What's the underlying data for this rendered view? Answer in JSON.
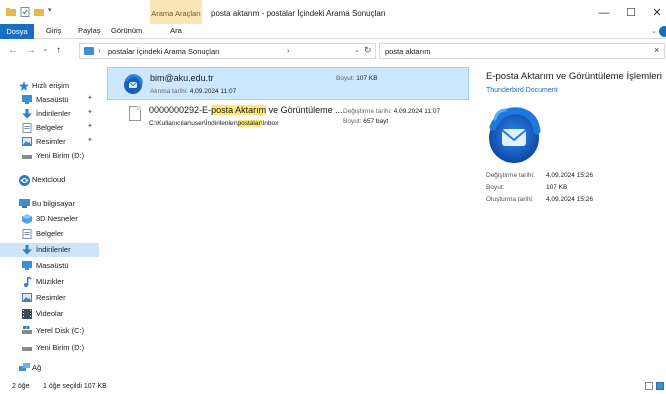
{
  "titlebar": {
    "tool_tab_top": "Arama Araçları",
    "window_title": "posta aktarım - postalar İçindeki Arama Sonuçları",
    "minimize_glyph": "—",
    "maximize_glyph": "☐",
    "close_glyph": "✕"
  },
  "ribbon": {
    "tabs": [
      "Dosya",
      "Giriş",
      "Paylaş",
      "Görünüm",
      "Ara"
    ]
  },
  "address": {
    "back": "←",
    "forward": "→",
    "recent": "⌄",
    "up": "↑",
    "sep": "›",
    "path": "postalar İçindeki Arama Sonuçları",
    "dropdown": "⌄",
    "refresh": "↻",
    "search_value": "posta aktarım",
    "search_clear": "×"
  },
  "nav": {
    "items": [
      {
        "label": "Hızlı erişim",
        "icon": "star-icon",
        "pinned": false
      },
      {
        "label": "Masaüstü",
        "icon": "desktop-icon",
        "pinned": true
      },
      {
        "label": "İndirilenler",
        "icon": "download-icon",
        "pinned": true
      },
      {
        "label": "Belgeler",
        "icon": "documents-icon",
        "pinned": true
      },
      {
        "label": "Resimler",
        "icon": "pictures-icon",
        "pinned": true
      },
      {
        "label": "Yeni Birim (D:)",
        "icon": "drive-icon",
        "pinned": false
      },
      {
        "label": "Nextcloud",
        "icon": "nextcloud-icon",
        "pinned": false
      },
      {
        "label": "Bu bilgisayar",
        "icon": "computer-icon",
        "pinned": false
      },
      {
        "label": "3D Nesneler",
        "icon": "3d-objects-icon",
        "pinned": false
      },
      {
        "label": "Belgeler",
        "icon": "documents-icon",
        "pinned": false
      },
      {
        "label": "İndirilenler",
        "icon": "download-icon",
        "pinned": false
      },
      {
        "label": "Masaüstü",
        "icon": "desktop-icon",
        "pinned": false
      },
      {
        "label": "Müzikler",
        "icon": "music-icon",
        "pinned": false
      },
      {
        "label": "Resimler",
        "icon": "pictures-icon",
        "pinned": false
      },
      {
        "label": "Videolar",
        "icon": "videos-icon",
        "pinned": false
      },
      {
        "label": "Yerel Disk (C:)",
        "icon": "drive-icon",
        "pinned": false
      },
      {
        "label": "Yeni Birim (D:)",
        "icon": "drive-icon",
        "pinned": false
      },
      {
        "label": "Ağ",
        "icon": "network-icon",
        "pinned": false
      }
    ],
    "pin_glyph": "✦"
  },
  "results": {
    "row1": {
      "title": "bim@aku.edu.tr",
      "sub_key": "Alınma tarihi:",
      "sub_val": "4.09.2024 11:07",
      "size_key": "Boyut:",
      "size_val": "107 KB"
    },
    "row2": {
      "title_a": "0000000292-E-",
      "title_hl": "posta Aktarım",
      "title_b": " ve Görüntüleme ...",
      "path_a": "C:\\Kullanıcılar\\user\\İndirilenler\\",
      "path_hl": "postalar",
      "path_b": "\\Inbox",
      "mod_key": "Değiştirme tarihi:",
      "mod_val": "4.09.2024 11:07",
      "size_key": "Boyut:",
      "size_val": "657 bayt"
    }
  },
  "preview": {
    "title": "E-posta Aktarım ve Görüntüleme İşlemleri",
    "type": "Thunderbird Document",
    "props": [
      {
        "key": "Değiştirme tarihi:",
        "value": "4.09.2024 15:26"
      },
      {
        "key": "Boyut:",
        "value": "107 KB"
      },
      {
        "key": "Oluşturma tarihi:",
        "value": "4.09.2024 15:26"
      }
    ]
  },
  "status": {
    "count": "2 öğe",
    "selected": "1 öğe seçildi  107 KB"
  },
  "colors": {
    "accent": "#1a6ec2",
    "selection": "#cce8ff",
    "highlight": "#ffe97a",
    "tool_tab": "#fbe6b3"
  }
}
